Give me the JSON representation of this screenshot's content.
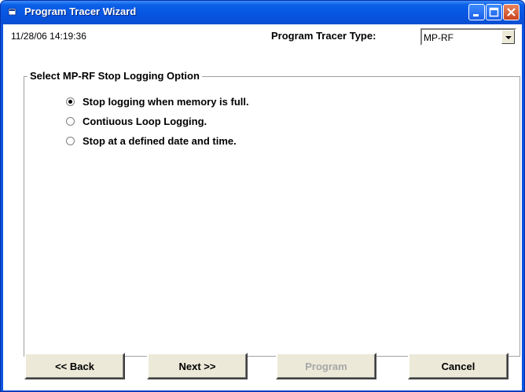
{
  "window": {
    "title": "Program Tracer Wizard"
  },
  "header": {
    "timestamp": "11/28/06 14:19:36",
    "type_label": "Program Tracer Type:",
    "type_value": "MP-RF"
  },
  "group": {
    "title": "Select MP-RF Stop Logging Option",
    "options": [
      {
        "label": "Stop logging when memory is full.",
        "checked": true
      },
      {
        "label": "Contiuous Loop Logging.",
        "checked": false
      },
      {
        "label": "Stop at a defined date and time.",
        "checked": false
      }
    ]
  },
  "buttons": {
    "back": "<< Back",
    "next": "Next >>",
    "program": "Program",
    "cancel": "Cancel"
  }
}
